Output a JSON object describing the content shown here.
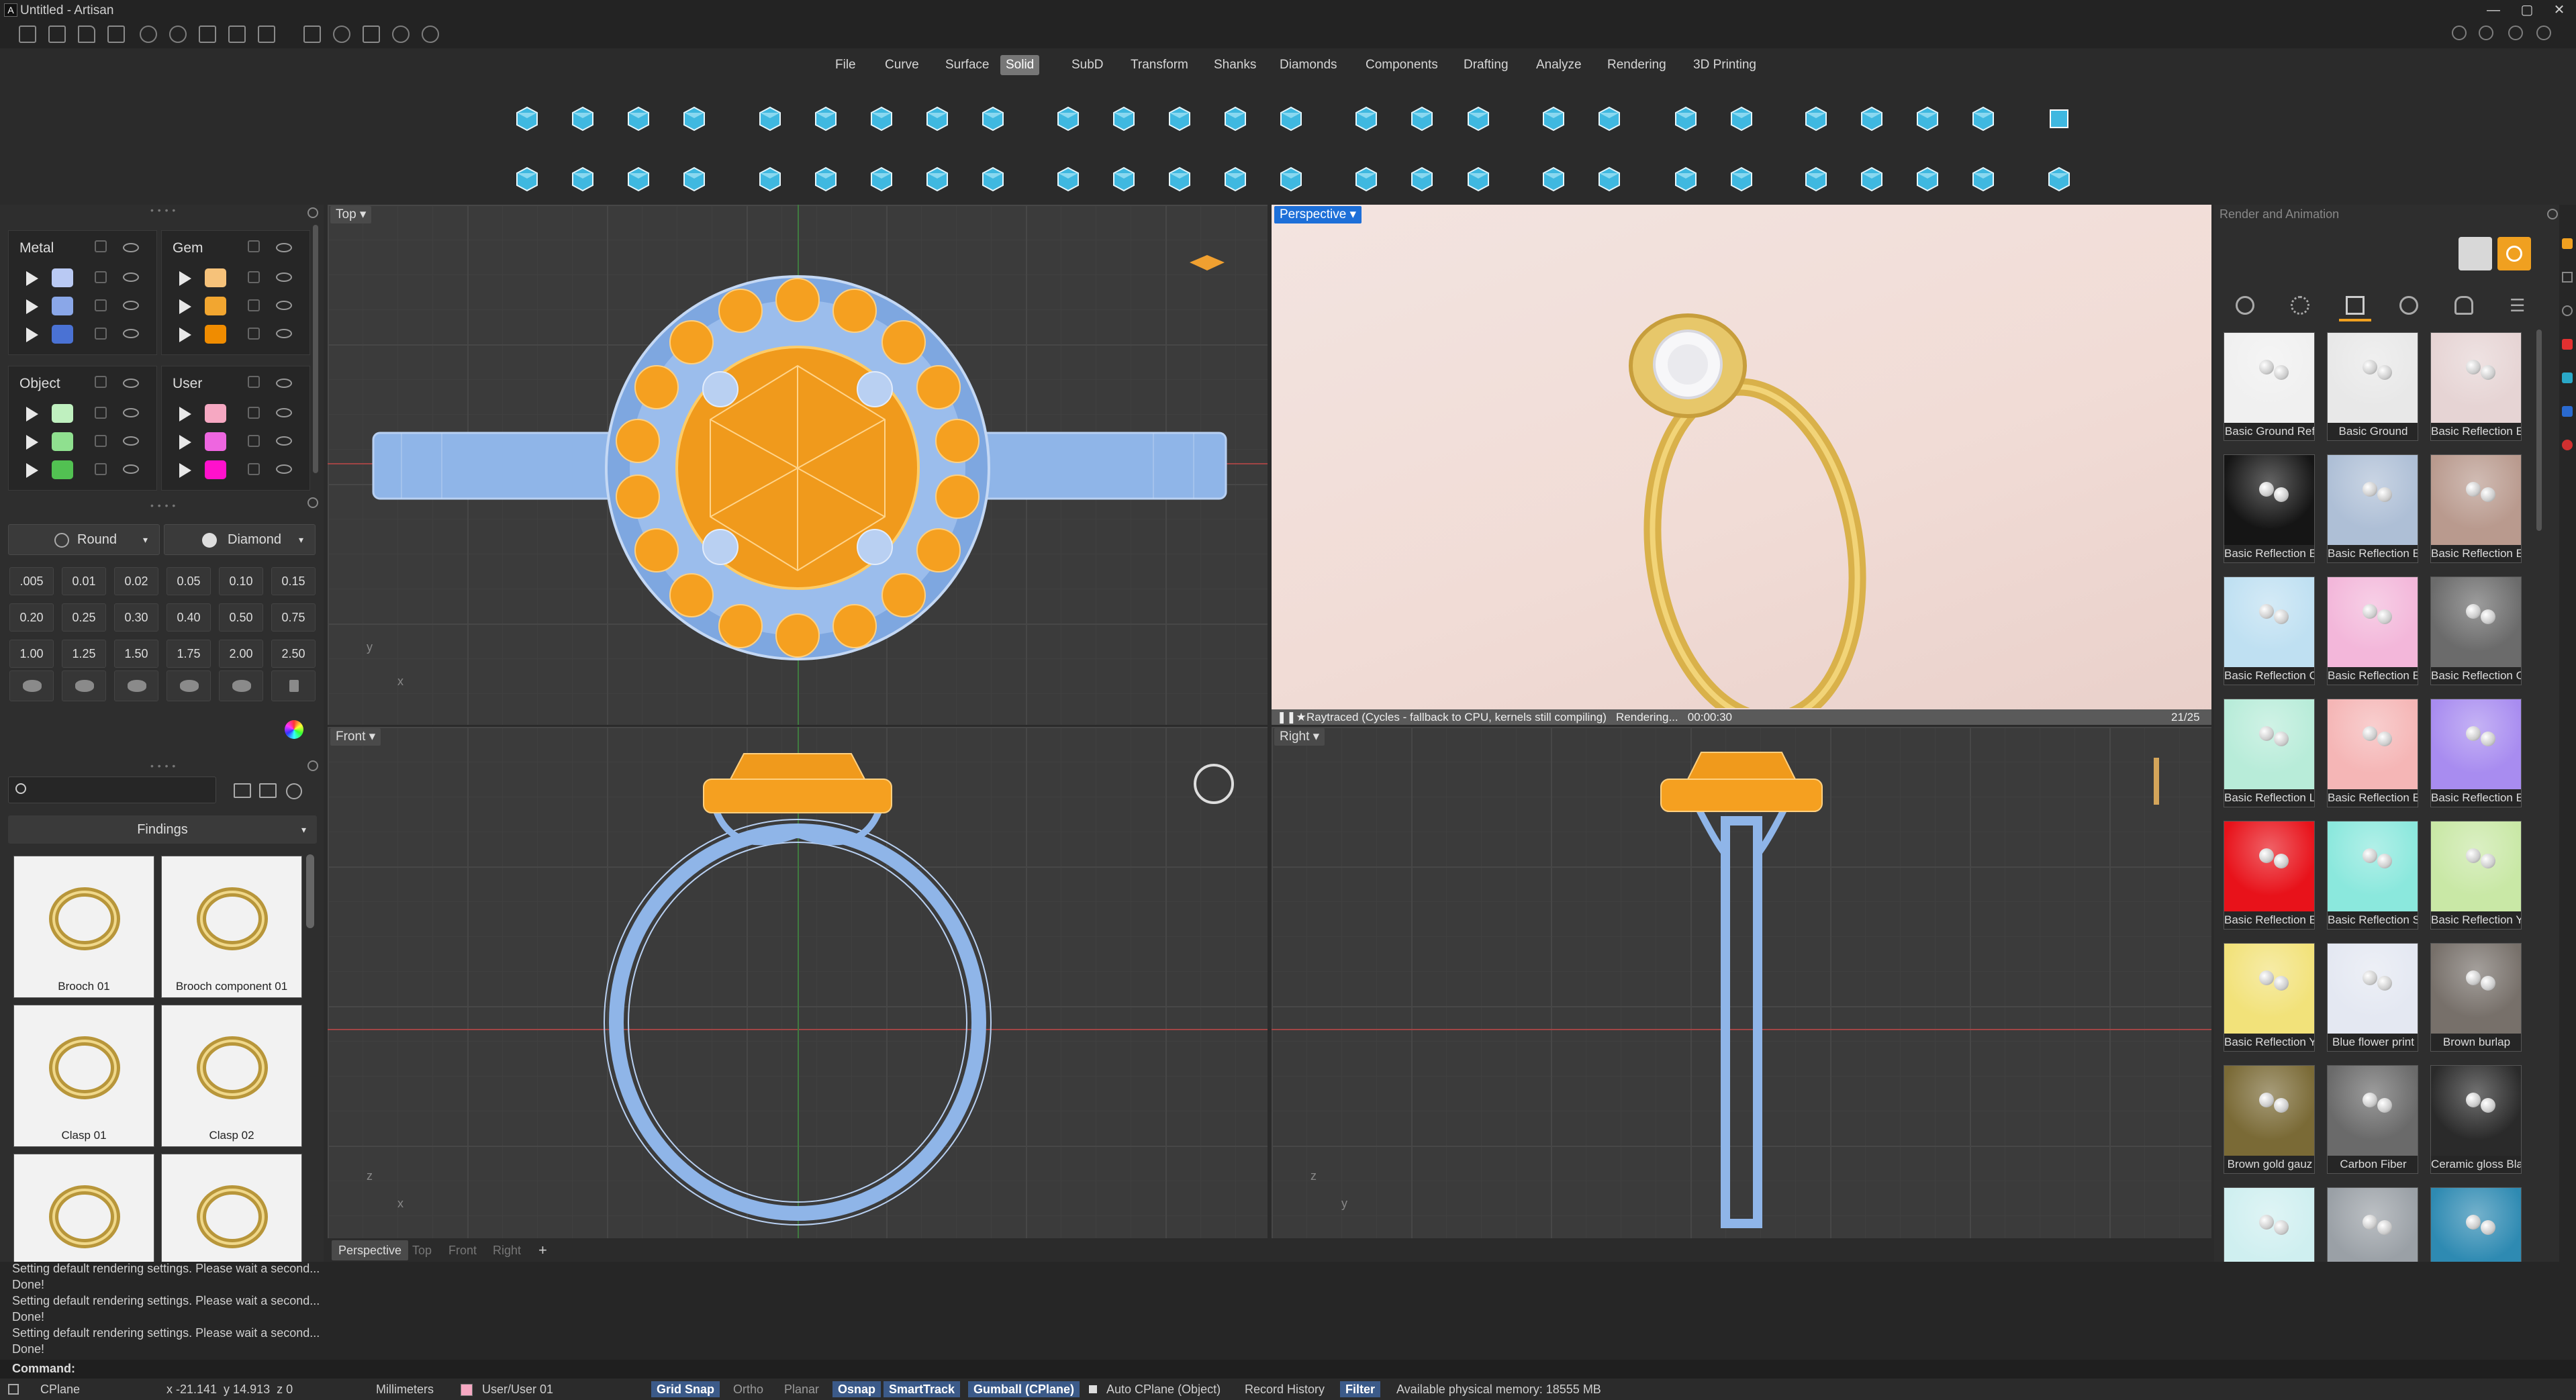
{
  "window": {
    "title": "Untitled - Artisan",
    "controls": [
      "—",
      "▢",
      "✕"
    ]
  },
  "menu": {
    "items": [
      "File",
      "Curve",
      "Surface",
      "Solid",
      "SubD",
      "Transform",
      "Shanks",
      "Diamonds",
      "Components",
      "Drafting",
      "Analyze",
      "Rendering",
      "3D Printing"
    ],
    "active": "Solid"
  },
  "layers": {
    "groups": [
      {
        "name": "Metal",
        "colors": [
          "#b9c9f3",
          "#8aa7e8",
          "#4a72d4"
        ]
      },
      {
        "name": "Gem",
        "colors": [
          "#f6c27a",
          "#f2a630",
          "#f08c00"
        ]
      },
      {
        "name": "Object",
        "colors": [
          "#bff0bf",
          "#8fe08f",
          "#52c152"
        ]
      },
      {
        "name": "User",
        "colors": [
          "#f6a8c2",
          "#ee66e0",
          "#ff11cc"
        ]
      }
    ]
  },
  "gem_tools": {
    "shape_label": "Round",
    "cut_label": "Diamond",
    "sizes": [
      ".005",
      "0.01",
      "0.02",
      "0.05",
      "0.10",
      "0.15",
      "0.20",
      "0.25",
      "0.30",
      "0.40",
      "0.50",
      "0.75",
      "1.00",
      "1.25",
      "1.50",
      "1.75",
      "2.00",
      "2.50"
    ]
  },
  "library": {
    "category": "Findings",
    "items": [
      {
        "label": "Brooch 01",
        "icon": "pin-icon"
      },
      {
        "label": "Brooch component 01",
        "icon": "brooch-component-icon"
      },
      {
        "label": "Clasp 01",
        "icon": "clasp-icon"
      },
      {
        "label": "Clasp 02",
        "icon": "clasp-icon"
      },
      {
        "label": "",
        "icon": "lobster-clasp-icon"
      },
      {
        "label": "",
        "icon": "cufflink-icon"
      }
    ]
  },
  "viewports": {
    "top": {
      "label": "Top"
    },
    "perspective": {
      "label": "Perspective",
      "status": "Raytraced (Cycles - fallback to CPU, kernels still compiling)   Rendering...   00:00:30",
      "progress": "21/25"
    },
    "front": {
      "label": "Front"
    },
    "right": {
      "label": "Right"
    },
    "tabs": [
      "Perspective",
      "Top",
      "Front",
      "Right"
    ],
    "active_tab": "Perspective"
  },
  "render_panel": {
    "title": "Render and Animation",
    "materials": [
      {
        "label": "Basic Ground Ref",
        "color": "#f0f0f0"
      },
      {
        "label": "Basic Ground",
        "color": "#e8e8e8"
      },
      {
        "label": "Basic Reflection E",
        "color": "#e6d4d4"
      },
      {
        "label": "Basic Reflection E",
        "color": "#151515"
      },
      {
        "label": "Basic Reflection E",
        "color": "#aebfd6"
      },
      {
        "label": "Basic Reflection E",
        "color": "#b99a8e"
      },
      {
        "label": "Basic Reflection C",
        "color": "#bfe0f2"
      },
      {
        "label": "Basic Reflection E",
        "color": "#f3b7da"
      },
      {
        "label": "Basic Reflection C",
        "color": "#6b6b6b"
      },
      {
        "label": "Basic Reflection L",
        "color": "#b8ecd9"
      },
      {
        "label": "Basic Reflection E",
        "color": "#f5b6b6"
      },
      {
        "label": "Basic Reflection E",
        "color": "#a88cf0"
      },
      {
        "label": "Basic Reflection E",
        "color": "#e8121a"
      },
      {
        "label": "Basic Reflection S",
        "color": "#8be8dd"
      },
      {
        "label": "Basic Reflection Y",
        "color": "#c9e8a6"
      },
      {
        "label": "Basic Reflection Y",
        "color": "#f2e27a"
      },
      {
        "label": "Blue flower print",
        "color": "#e4e8f2"
      },
      {
        "label": "Brown burlap",
        "color": "#77706a"
      },
      {
        "label": "Brown gold gauz",
        "color": "#7a6a36"
      },
      {
        "label": "Carbon Fiber",
        "color": "#6a6a6a"
      },
      {
        "label": "Ceramic gloss Bla",
        "color": "#2a2a2a"
      },
      {
        "label": "",
        "color": "#cfeff0"
      },
      {
        "label": "",
        "color": "#9aa0a6"
      },
      {
        "label": "",
        "color": "#2e8ab2"
      }
    ]
  },
  "command": {
    "log": [
      "Setting default rendering settings. Please wait a second...",
      "Done!",
      "Setting default rendering settings. Please wait a second...",
      "Done!",
      "Setting default rendering settings. Please wait a second...",
      "Done!"
    ],
    "prompt": "Command:"
  },
  "status": {
    "cplane": "CPlane",
    "coords": "x -21.141  y 14.913  z 0",
    "units": "Millimeters",
    "layer": "User/User 01",
    "layer_color": "#f6a8c2",
    "toggles": [
      {
        "label": "Grid Snap",
        "on": true
      },
      {
        "label": "Ortho",
        "on": false
      },
      {
        "label": "Planar",
        "on": false
      },
      {
        "label": "Osnap",
        "on": true
      },
      {
        "label": "SmartTrack",
        "on": true
      },
      {
        "label": "Gumball (CPlane)",
        "on": true
      },
      {
        "label": "Auto CPlane (Object)",
        "on": false
      },
      {
        "label": "Record History",
        "on": false
      },
      {
        "label": "Filter",
        "on": true
      }
    ],
    "memory": "Available physical memory: 18555 MB"
  }
}
